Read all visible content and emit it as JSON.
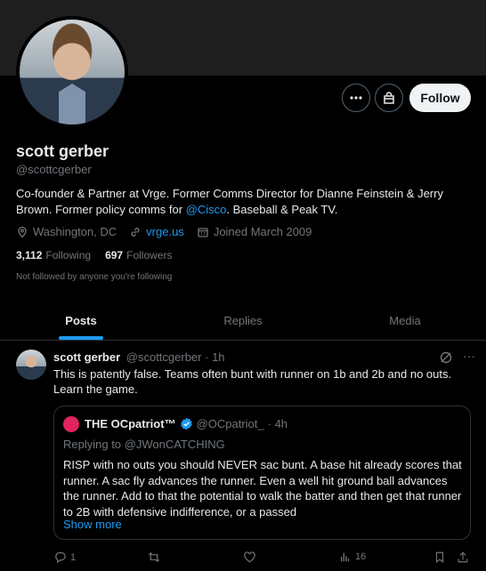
{
  "profile": {
    "name": "scott gerber",
    "handle": "@scottcgerber",
    "bio_prefix": "Co-founder & Partner at Vrge.  Former Comms Director for Dianne Feinstein & Jerry Brown.  Former policy comms for ",
    "bio_link": "@Cisco",
    "bio_suffix": ".  Baseball & Peak TV.",
    "location": "Washington, DC",
    "website": "vrge.us",
    "joined": "Joined March 2009",
    "following_count": "3,112",
    "following_label": "Following",
    "followers_count": "697",
    "followers_label": "Followers",
    "not_followed": "Not followed by anyone you're following",
    "follow_label": "Follow"
  },
  "tabs": [
    {
      "label": "Posts"
    },
    {
      "label": "Replies"
    },
    {
      "label": "Media"
    }
  ],
  "tweet": {
    "name": "scott gerber",
    "handle": "@scottcgerber",
    "time": "· 1h",
    "text": "This is patently false.  Teams often bunt with runner on 1b and 2b and no outs.  Learn the game.",
    "quote": {
      "name": "THE OCpatriot™",
      "handle": "@OCpatriot_",
      "time": "· 4h",
      "replying_to": "Replying to @JWonCATCHING",
      "text": "RISP with no outs you should NEVER sac bunt. A base hit already scores that runner. A sac fly advances the runner. Even a well hit ground ball advances the runner. Add to that the potential to walk the batter and then get that runner to 2B with defensive indifference, or a passed",
      "show_more": "Show more"
    },
    "actions": {
      "replies": "1",
      "views": "16"
    }
  },
  "colors": {
    "accent": "#1d9bf0",
    "muted": "#71767b",
    "background": "#000000"
  }
}
